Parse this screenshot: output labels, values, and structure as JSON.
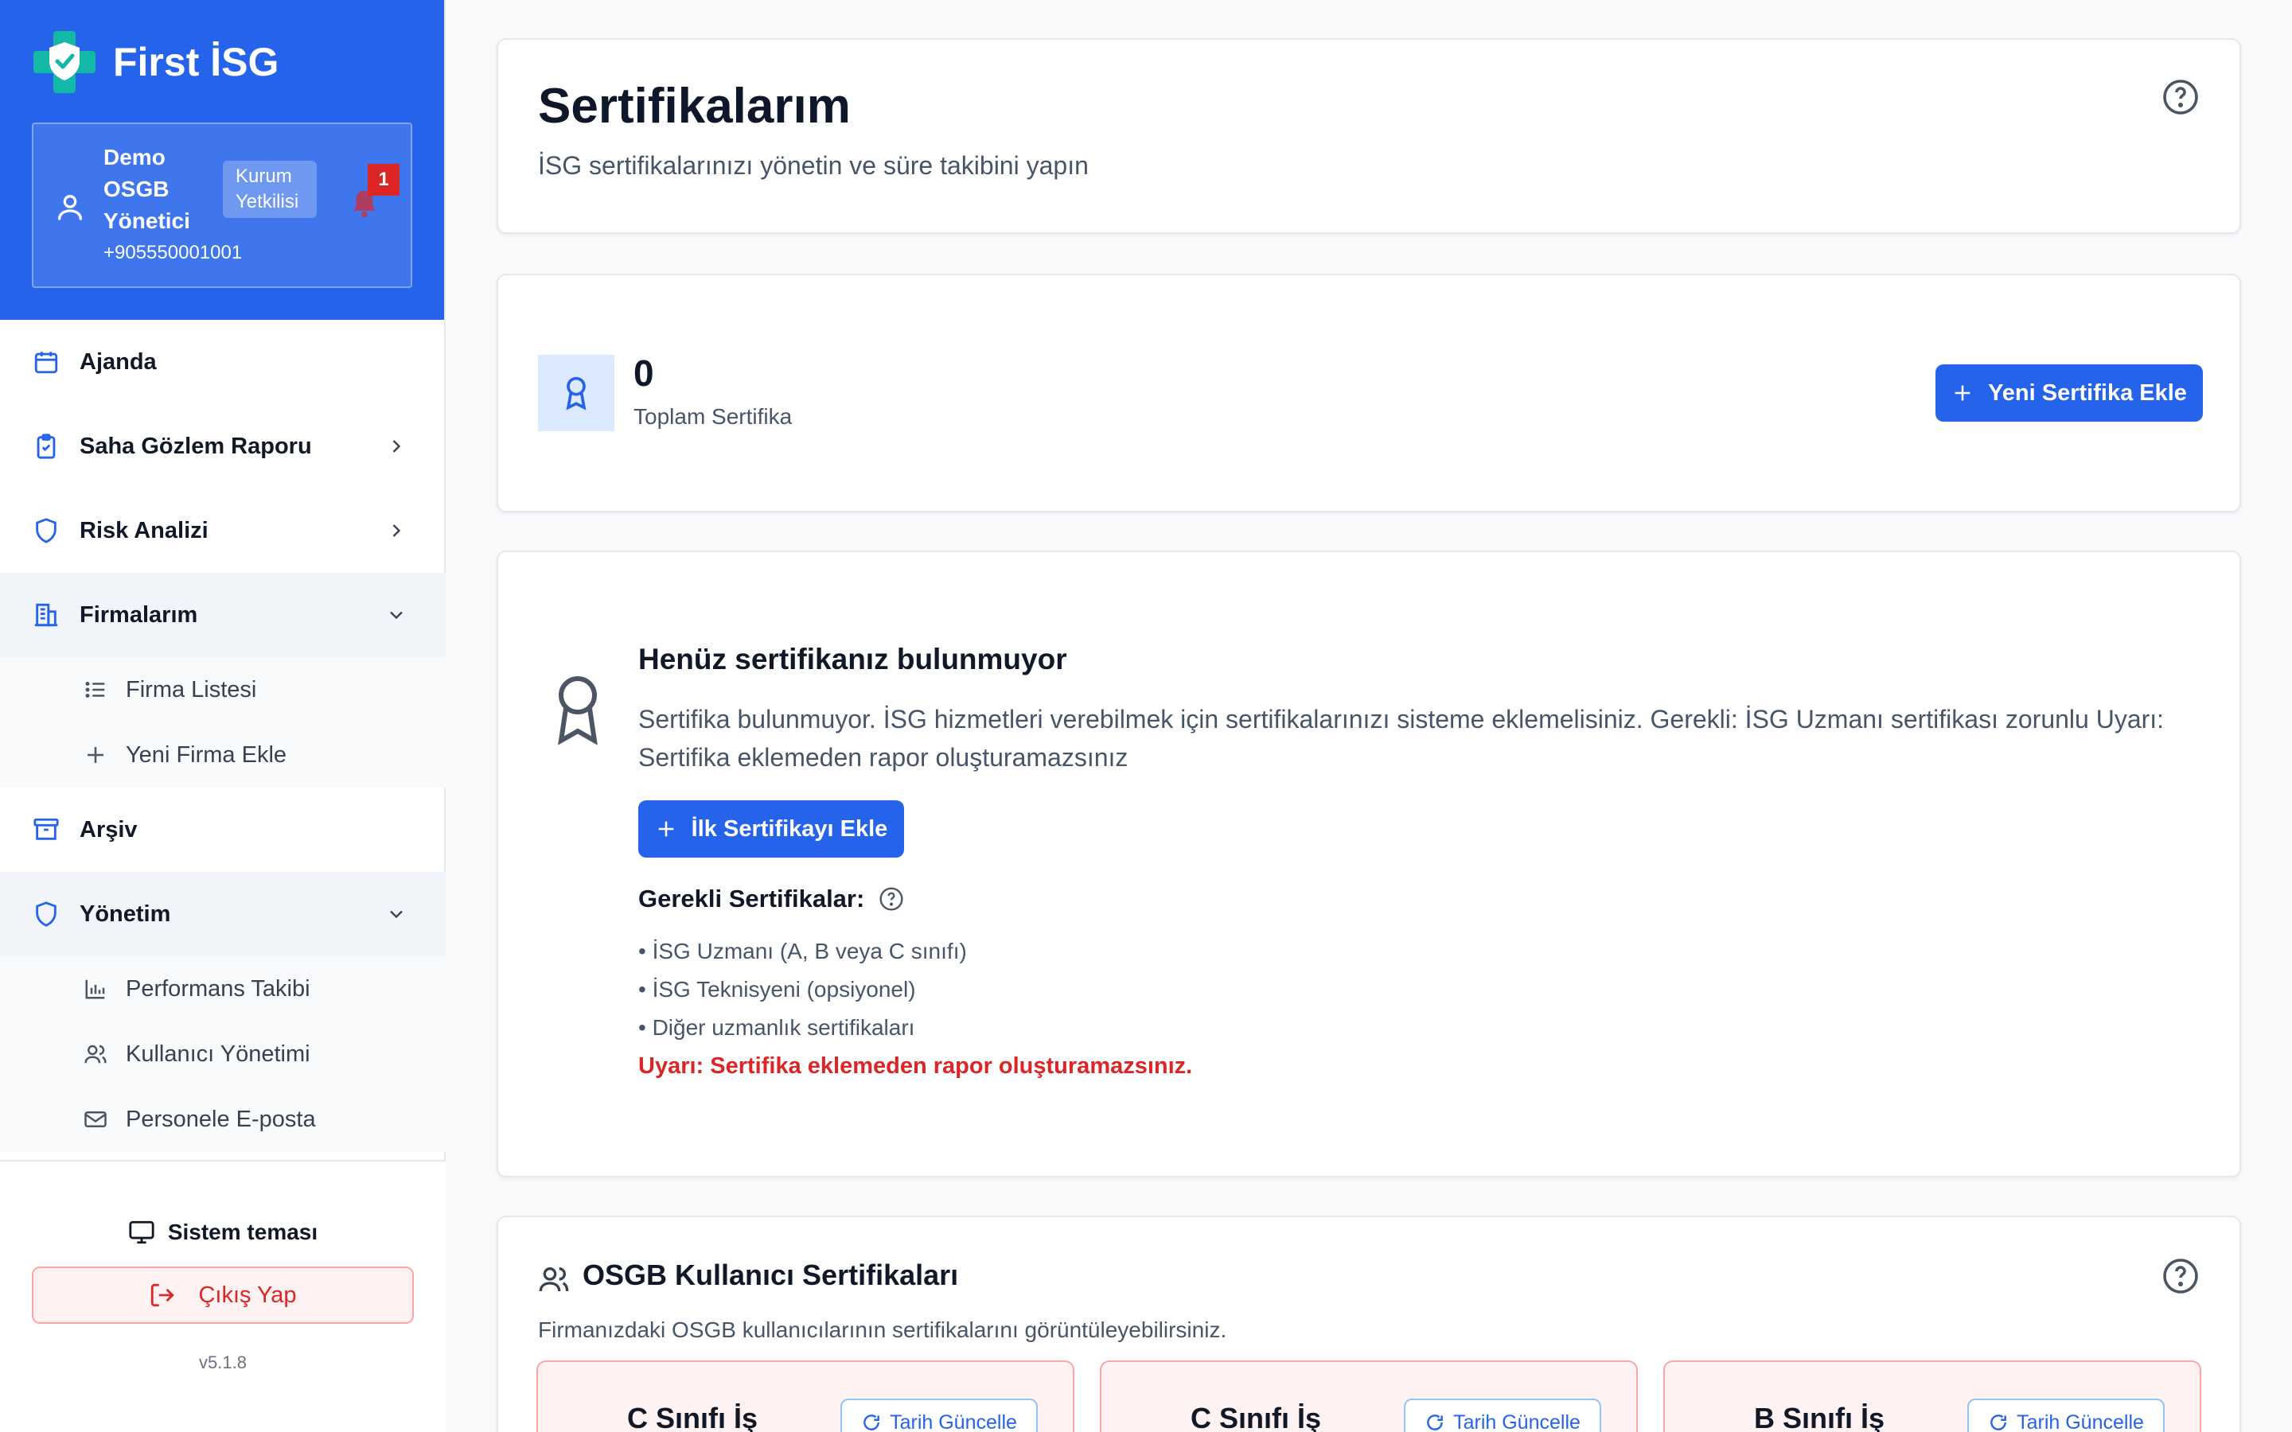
{
  "brand": {
    "name": "First İSG"
  },
  "user": {
    "name": "Demo OSGB Yönetici",
    "role": "Kurum Yetkilisi",
    "phone": "+905550001001",
    "notifications": "1"
  },
  "nav": {
    "items": [
      {
        "label": "Ajanda",
        "icon": "calendar-icon"
      },
      {
        "label": "Saha Gözlem Raporu",
        "icon": "clipboard-check-icon"
      },
      {
        "label": "Risk Analizi",
        "icon": "shield-icon"
      },
      {
        "label": "Firmalarım",
        "icon": "building-icon"
      },
      {
        "label": "Arşiv",
        "icon": "archive-icon"
      },
      {
        "label": "Yönetim",
        "icon": "shield-icon"
      }
    ],
    "firmalar_sub": [
      {
        "label": "Firma Listesi",
        "icon": "list-icon"
      },
      {
        "label": "Yeni Firma Ekle",
        "icon": "plus-icon"
      }
    ],
    "yonetim_sub": [
      {
        "label": "Performans Takibi",
        "icon": "bar-chart-icon"
      },
      {
        "label": "Kullanıcı Yönetimi",
        "icon": "users-icon"
      },
      {
        "label": "Personele E-posta",
        "icon": "mail-icon"
      }
    ]
  },
  "footer": {
    "theme": "Sistem teması",
    "logout": "Çıkış Yap",
    "version": "v5.1.8"
  },
  "header": {
    "title": "Sertifikalarım",
    "subtitle": "İSG sertifikalarınızı yönetin ve süre takibini yapın"
  },
  "stats": {
    "total": "0",
    "total_label": "Toplam Sertifika",
    "new_button": "Yeni Sertifika Ekle"
  },
  "empty": {
    "title": "Henüz sertifikanız bulunmuyor",
    "description": "Sertifika bulunmuyor. İSG hizmetleri verebilmek için sertifikalarınızı sisteme eklemelisiniz. Gerekli: İSG Uzmanı sertifikası zorunlu Uyarı: Sertifika eklemeden rapor oluşturamazsınız",
    "button": "İlk Sertifikayı Ekle",
    "required_title": "Gerekli Sertifikalar:",
    "required": [
      "• İSG Uzmanı (A, B veya C sınıfı)",
      "• İSG Teknisyeni (opsiyonel)",
      "• Diğer uzmanlık sertifikaları"
    ],
    "warning": "Uyarı: Sertifika eklemeden rapor oluşturamazsınız."
  },
  "osgb": {
    "title": "OSGB Kullanıcı Sertifikaları",
    "subtitle": "Firmanızdaki OSGB kullanıcılarının sertifikalarını görüntüleyebilirsiniz.",
    "cards": [
      {
        "title": "C Sınıfı İş",
        "button": "Tarih Güncelle"
      },
      {
        "title": "C Sınıfı İş",
        "button": "Tarih Güncelle"
      },
      {
        "title": "B Sınıfı İş",
        "button": "Tarih Güncelle"
      }
    ]
  },
  "colors": {
    "primary": "#2563eb",
    "danger": "#dc2626",
    "sidebar_header": "#2563eb"
  }
}
